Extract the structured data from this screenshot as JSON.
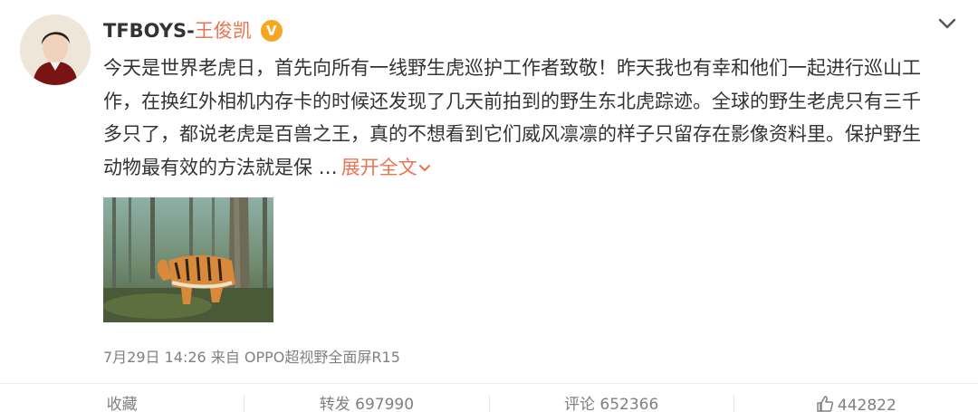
{
  "author": {
    "name_en": "TFBOYS-",
    "name_cn": "王俊凯",
    "badge": "V"
  },
  "post": {
    "lines": [
      "今天是世界老虎日，首先向所有一线野生虎巡护工作者致敬！昨天我也有幸和他们一起进行巡山工",
      "作，在换红外相机内存卡的时候还发现了几天前拍到的野生东北虎踪迹。全球的野生老虎只有三千",
      "多只了，都说老虎是百兽之王，真的不想看到它们威风凛凛的样子只留存在影像资料里。保护野生",
      "动物最有效的方法就是保 …"
    ],
    "expand_label": "展开全文"
  },
  "meta": {
    "text": "7月29日 14:26 来自 OPPO超视野全面屏R15"
  },
  "actions": {
    "favorite": "收藏",
    "repost": "转发 697990",
    "comment": "评论 652366",
    "like": "442822"
  },
  "colors": {
    "accent": "#eb7350",
    "text": "#333333",
    "muted": "#808080",
    "verified": "#f5a623"
  },
  "icons": {
    "expand": "chevron-down-icon",
    "menu": "chevron-down-icon",
    "like": "thumbs-up-icon",
    "verified": "verified-badge-icon"
  }
}
